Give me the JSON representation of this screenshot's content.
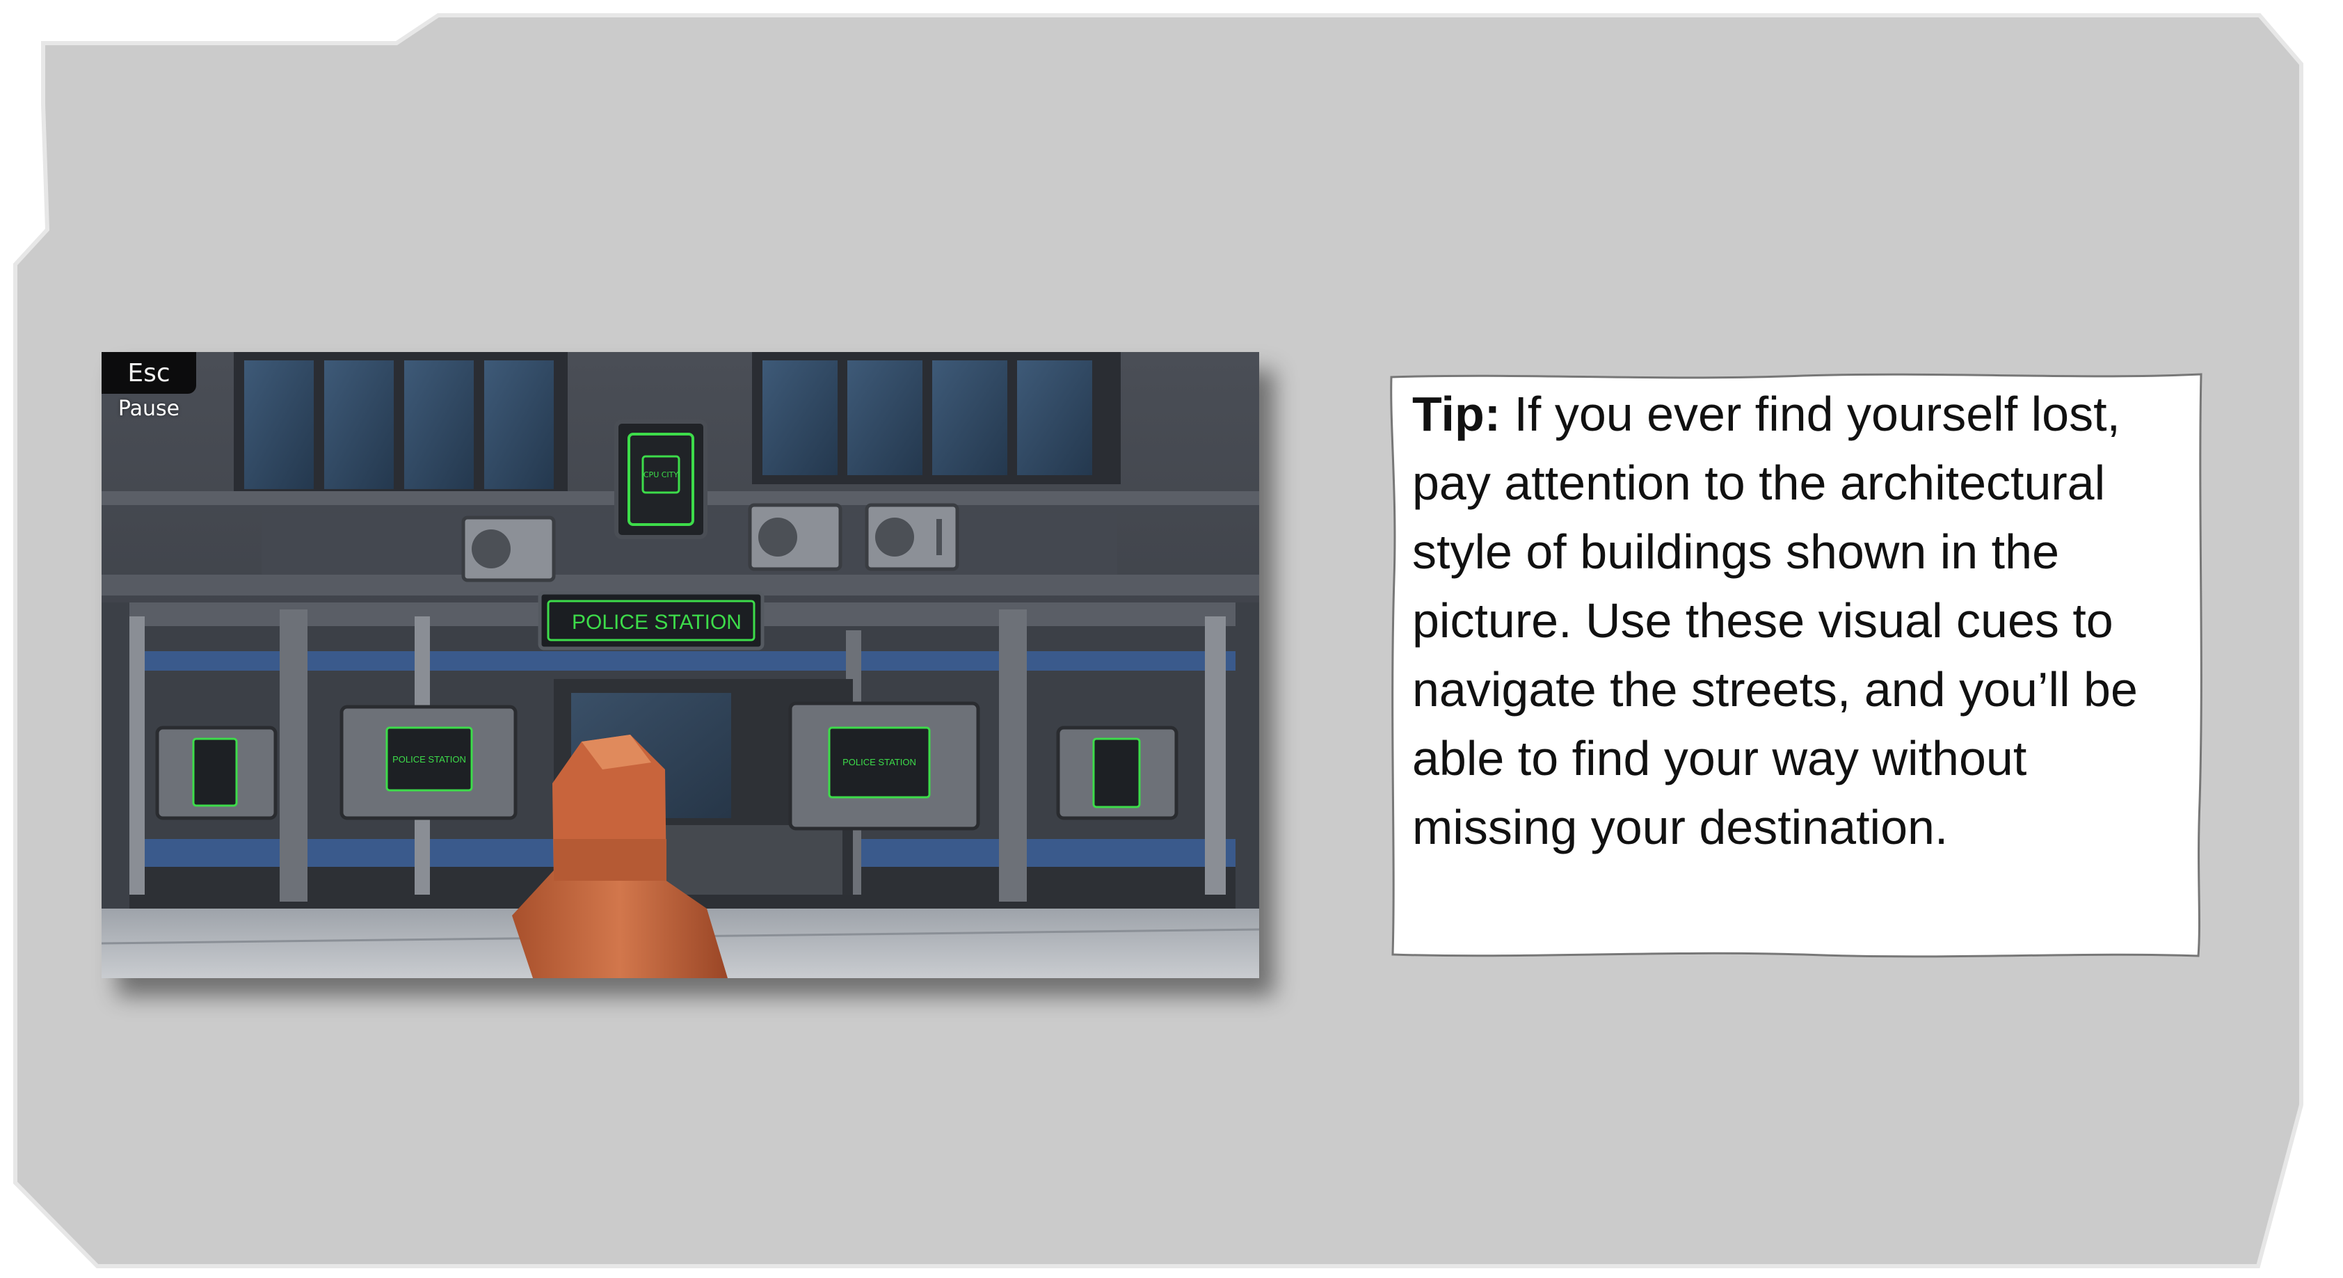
{
  "hud": {
    "esc_key": "Esc",
    "esc_action": "Pause"
  },
  "scene": {
    "main_sign": "POLICE STATION",
    "logo_sign": "CPU CITY",
    "window_sign_left": "POLICE STATION",
    "window_sign_right": "POLICE STATION",
    "colors": {
      "neon_green": "#3ddc4a",
      "wall_blue": "#3a5a8c",
      "character_orange": "#c8643c",
      "frame_gray": "#cbcbcb"
    }
  },
  "tip": {
    "label": "Tip:",
    "text": "If you ever find yourself lost, pay attention to the architectural style of buildings shown in the picture. Use these visual cues to navigate the streets, and you’ll be able to find your way without missing your destination."
  }
}
